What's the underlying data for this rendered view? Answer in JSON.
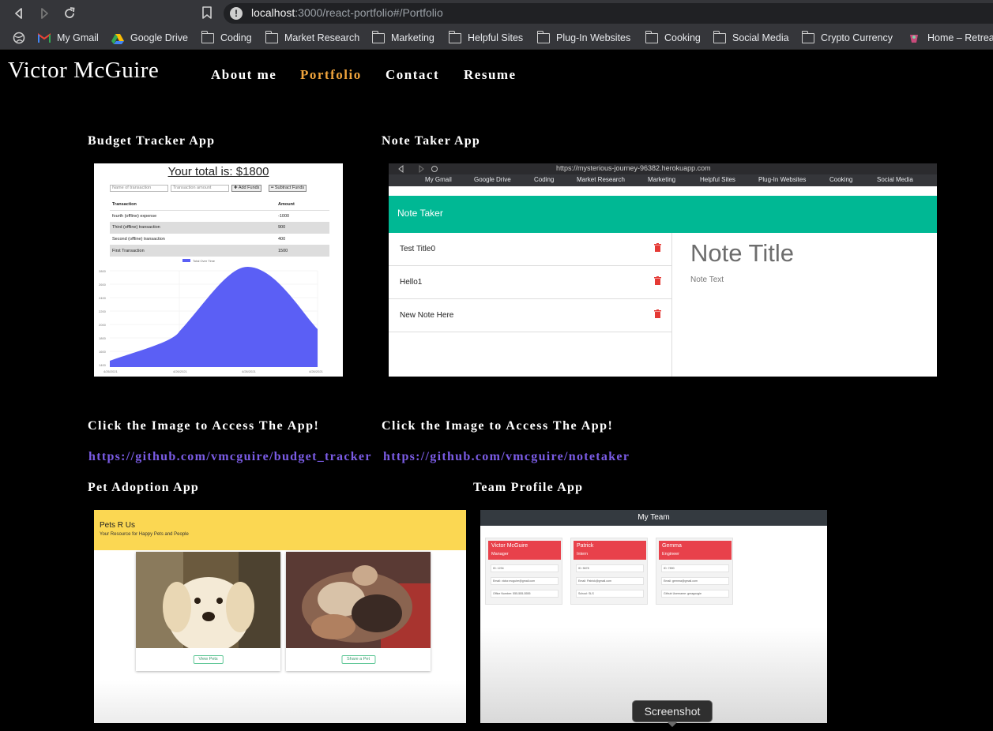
{
  "browser": {
    "url_host": "localhost",
    "url_path": ":3000/react-portfolio#/Portfolio",
    "bookmarks": [
      "My Gmail",
      "Google Drive",
      "Coding",
      "Market Research",
      "Marketing",
      "Helpful Sites",
      "Plug-In Websites",
      "Cooking",
      "Social Media",
      "Crypto Currency",
      "Home – Retrea"
    ]
  },
  "site": {
    "brand": "Victor McGuire",
    "nav": [
      "About me",
      "Portfolio",
      "Contact",
      "Resume"
    ],
    "active_nav": "Portfolio",
    "accent_color": "#f0a43c",
    "link_color": "#7b5ce6"
  },
  "projects": [
    {
      "title": "Budget Tracker App",
      "cta": "Click the Image to Access The App!",
      "link": "https://github.com/vmcguire/budget_tracker",
      "thumb": {
        "total": "Your total is: $1800",
        "inputs": [
          "Name of transaction",
          "Transaction amount"
        ],
        "buttons": [
          "✚ Add Funds",
          "━ Subtract Funds"
        ],
        "table_headers": [
          "Transaction",
          "Amount"
        ],
        "rows": [
          [
            "fourth (offline) expense",
            "-1000"
          ],
          [
            "Third (offline) transaction",
            "900"
          ],
          [
            "Second (offline) transaction",
            "400"
          ],
          [
            "First Transaction",
            "1500"
          ]
        ],
        "legend": "Total Over Time"
      }
    },
    {
      "title": "Note Taker App",
      "cta": "Click the Image to Access The App!",
      "link": "https://github.com/vmcguire/notetaker",
      "thumb": {
        "url": "https://mysterious-journey-96382.herokuapp.com",
        "bookmarks": [
          "My Gmail",
          "Google Drive",
          "Coding",
          "Market Research",
          "Marketing",
          "Helpful Sites",
          "Plug-In Websites",
          "Cooking",
          "Social Media"
        ],
        "brand": "Note Taker",
        "notes": [
          "Test Title0",
          "Hello1",
          "New Note Here"
        ],
        "note_title": "Note Title",
        "note_text": "Note Text",
        "header_color": "#00b894"
      }
    },
    {
      "title": "Pet Adoption App",
      "thumb": {
        "brand": "Pets R Us",
        "tagline": "Your Resource for Happy Pets and People",
        "buttons": [
          "View Pets",
          "Share a Pet"
        ],
        "header_color": "#fbd752"
      }
    },
    {
      "title": "Team Profile App",
      "thumb": {
        "header": "My Team",
        "members": [
          {
            "name": "Victor McGuire",
            "role": "Manager",
            "rows": [
              "ID: 1234",
              "Email: victor.mcguire@gmail.com",
              "Office Number: 555-555-5555"
            ]
          },
          {
            "name": "Patrick",
            "role": "Intern",
            "rows": [
              "ID: 5678",
              "Email: Patrick@gmail.com",
              "School: SLS"
            ]
          },
          {
            "name": "Gemma",
            "role": "Engineer",
            "rows": [
              "ID: 7890",
              "Email: gemma@gmail.com",
              "Github Username: gmagoogie"
            ]
          }
        ]
      }
    }
  ],
  "tooltip": "Screenshot"
}
